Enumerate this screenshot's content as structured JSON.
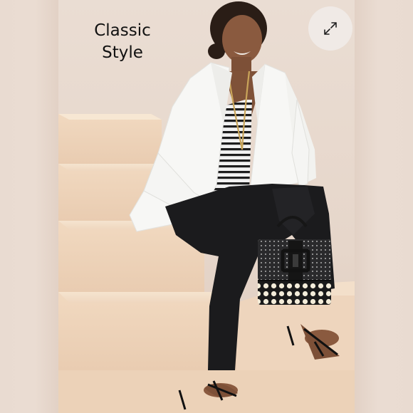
{
  "caption": {
    "line1": "Classic",
    "line2": "Style"
  },
  "expand_button": {
    "icon": "expand-arrows-icon"
  },
  "colors": {
    "background": "#ecdfd5",
    "blazer": "#f7f7f5",
    "trousers": "#1b1b1d",
    "bag_dots": "#f3ecd9",
    "steps": "#f2ddc6"
  }
}
